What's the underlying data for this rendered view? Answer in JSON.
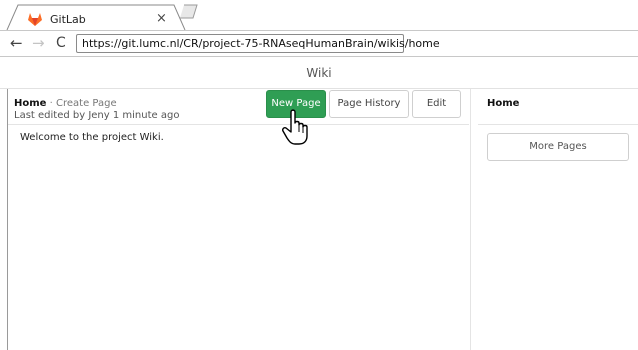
{
  "browser": {
    "tab": {
      "title": "GitLab",
      "close_glyph": "×",
      "favicon": "gitlab-logo-icon"
    },
    "nav": {
      "back_glyph": "←",
      "forward_glyph": "→",
      "reload_glyph": "C"
    },
    "url": "https://git.lumc.nl/CR/project-75-RNAseqHumanBrain/wikis/home"
  },
  "page": {
    "header_title": "Wiki",
    "breadcrumb": {
      "home": "Home",
      "separator": "·",
      "create_page": "Create Page"
    },
    "last_edited": "Last edited by Jeny 1 minute ago",
    "buttons": {
      "new_page": "New Page",
      "page_history": "Page History",
      "edit": "Edit"
    },
    "content": "Welcome to the project Wiki.",
    "sidebar": {
      "title": "Home",
      "more_pages": "More Pages"
    }
  },
  "colors": {
    "accent_green": "#2f9e54",
    "gitlab_orange": "#e2432a"
  },
  "pointer": "hand-cursor-icon"
}
